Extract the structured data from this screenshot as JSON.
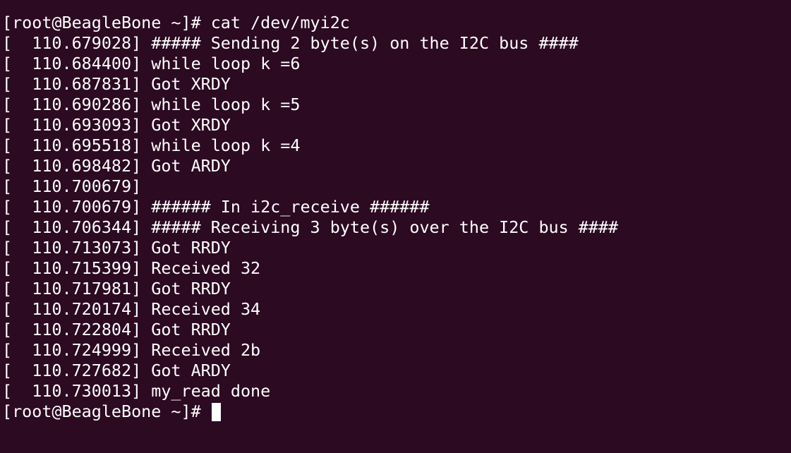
{
  "terminal": {
    "colors": {
      "background": "#2c0a22",
      "foreground": "#ffffff"
    },
    "command_line": "[root@BeagleBone ~]# cat /dev/myi2c",
    "lines": [
      "[  110.679028] ##### Sending 2 byte(s) on the I2C bus ####",
      "[  110.684400] while loop k =6",
      "[  110.687831] Got XRDY",
      "[  110.690286] while loop k =5",
      "[  110.693093] Got XRDY",
      "[  110.695518] while loop k =4",
      "[  110.698482] Got ARDY",
      "[  110.700679]",
      "[  110.700679] ###### In i2c_receive ######",
      "[  110.706344] ##### Receiving 3 byte(s) over the I2C bus ####",
      "[  110.713073] Got RRDY",
      "[  110.715399] Received 32",
      "[  110.717981] Got RRDY",
      "[  110.720174] Received 34",
      "[  110.722804] Got RRDY",
      "[  110.724999] Received 2b",
      "[  110.727682] Got ARDY",
      "[  110.730013] my_read done"
    ],
    "prompt": "[root@BeagleBone ~]# "
  }
}
